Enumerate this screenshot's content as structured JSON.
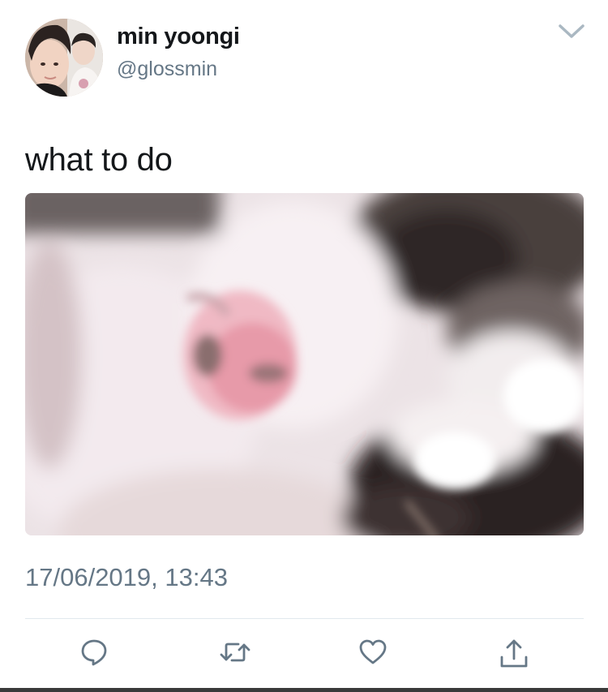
{
  "user": {
    "display_name": "min yoongi",
    "handle": "@glossmin",
    "avatar_icon": "profile-photo"
  },
  "tweet": {
    "text": "what to do",
    "timestamp": "17/06/2019, 13:43",
    "media_icon": "cat-photo"
  },
  "menu": {
    "icon": "chevron-down-icon"
  },
  "actions": [
    {
      "name": "reply",
      "icon": "reply-icon"
    },
    {
      "name": "retweet",
      "icon": "retweet-icon"
    },
    {
      "name": "like",
      "icon": "heart-icon"
    },
    {
      "name": "share",
      "icon": "share-icon"
    }
  ],
  "colors": {
    "primary_text": "#14171a",
    "secondary_text": "#657786",
    "divider": "#e1e8ed",
    "icon": "#657786"
  }
}
